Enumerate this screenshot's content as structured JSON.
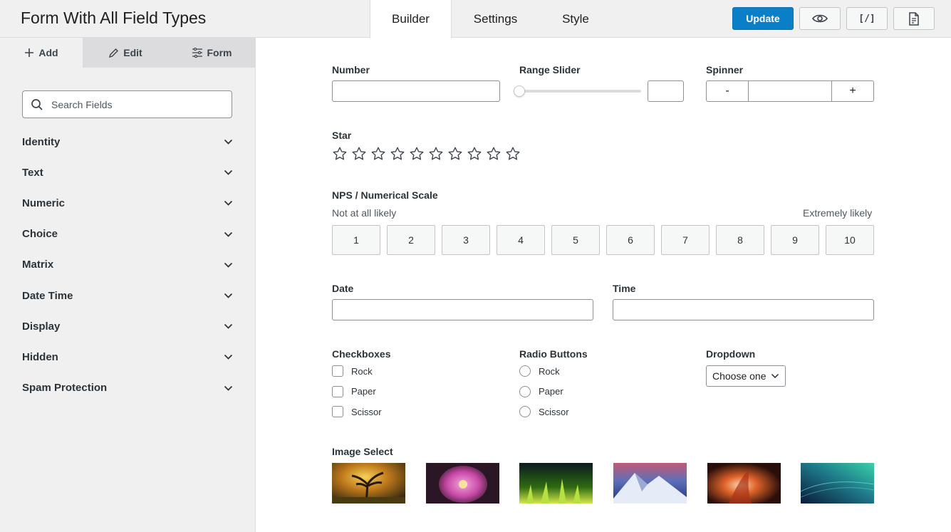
{
  "header": {
    "title": "Form With All Field Types",
    "tabs": [
      {
        "label": "Builder",
        "active": true
      },
      {
        "label": "Settings",
        "active": false
      },
      {
        "label": "Style",
        "active": false
      }
    ],
    "update_label": "Update",
    "icons": [
      "eye-icon",
      "shortcode-icon",
      "document-icon"
    ],
    "shortcode_glyph": "[/]",
    "accent_color": "#0a7fc7"
  },
  "sidebar": {
    "tabs": [
      {
        "label": "Add",
        "icon": "plus-icon"
      },
      {
        "label": "Edit",
        "icon": "pencil-icon"
      },
      {
        "label": "Form",
        "icon": "sliders-icon"
      }
    ],
    "search_placeholder": "Search Fields",
    "categories": [
      "Identity",
      "Text",
      "Numeric",
      "Choice",
      "Matrix",
      "Date Time",
      "Display",
      "Hidden",
      "Spam Protection"
    ]
  },
  "form": {
    "number_label": "Number",
    "range_label": "Range Slider",
    "range_value_fraction": 0,
    "spinner_label": "Spinner",
    "spinner_minus": "-",
    "spinner_plus": "+",
    "star_label": "Star",
    "star_count": 10,
    "nps_label": "NPS / Numerical Scale",
    "nps_low": "Not at all likely",
    "nps_high": "Extremely likely",
    "nps_values": [
      "1",
      "2",
      "3",
      "4",
      "5",
      "6",
      "7",
      "8",
      "9",
      "10"
    ],
    "date_label": "Date",
    "time_label": "Time",
    "checkboxes_label": "Checkboxes",
    "checkboxes": [
      "Rock",
      "Paper",
      "Scissor"
    ],
    "radio_label": "Radio Buttons",
    "radios": [
      "Rock",
      "Paper",
      "Scissor"
    ],
    "dropdown_label": "Dropdown",
    "dropdown_value": "Choose one",
    "image_select_label": "Image Select",
    "images": [
      "tree-sunset-image",
      "pink-flower-image",
      "green-grass-image",
      "snowy-mountain-image",
      "orange-canyon-image",
      "teal-abstract-image"
    ]
  }
}
